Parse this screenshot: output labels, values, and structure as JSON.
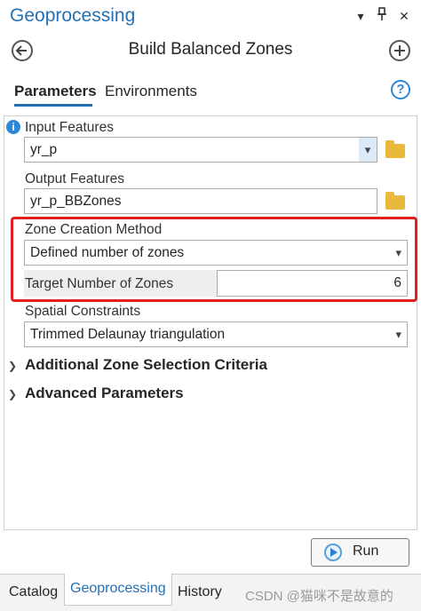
{
  "pane": {
    "title": "Geoprocessing",
    "icons": [
      "chevron-down-icon",
      "pin-icon",
      "close-icon"
    ]
  },
  "header": {
    "tool_title": "Build Balanced Zones",
    "back_icon": "back-arrow-icon",
    "add_icon": "plus-icon"
  },
  "tabs": {
    "parameters": "Parameters",
    "environments": "Environments",
    "help": "?"
  },
  "params": {
    "input_features_label": "Input Features",
    "input_features_value": "yr_p",
    "output_features_label": "Output Features",
    "output_features_value": "yr_p_BBZones",
    "zone_method_label": "Zone Creation Method",
    "zone_method_value": "Defined number of zones",
    "target_zones_label": "Target Number of Zones",
    "target_zones_value": "6",
    "spatial_constraints_label": "Spatial Constraints",
    "spatial_constraints_value": "Trimmed Delaunay triangulation",
    "section_additional": "Additional Zone Selection Criteria",
    "section_advanced": "Advanced Parameters"
  },
  "run": {
    "label": "Run"
  },
  "bottom_tabs": {
    "catalog": "Catalog",
    "geoprocessing": "Geoprocessing",
    "history": "History"
  },
  "watermark": "CSDN @猫咪不是故意的",
  "colors": {
    "accent": "#2470b3",
    "highlight": "#e02020",
    "folder": "#e8b93a",
    "info": "#2d87d8"
  }
}
